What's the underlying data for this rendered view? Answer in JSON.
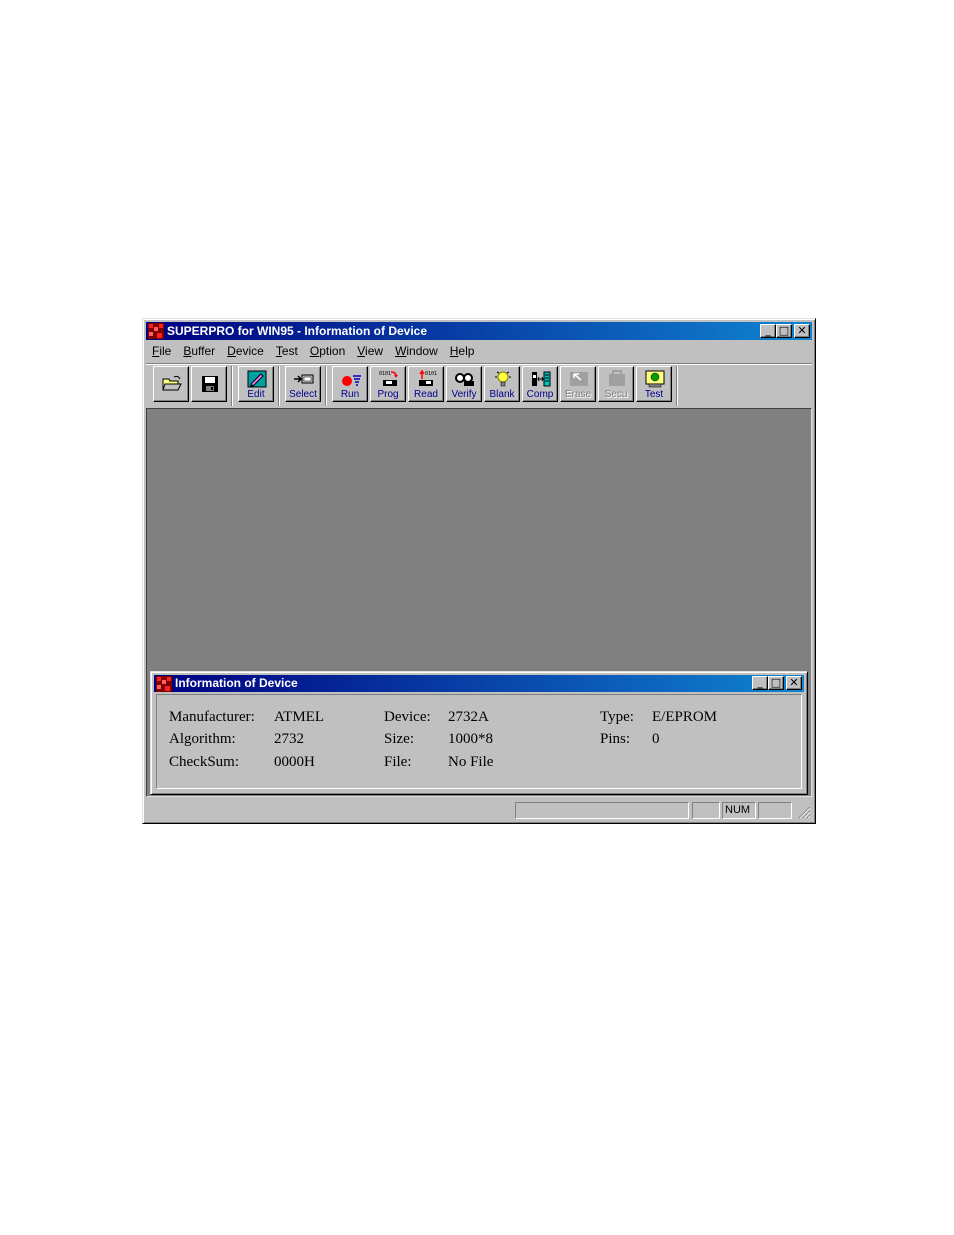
{
  "window": {
    "title": "SUPERPRO for WIN95 - Information of Device",
    "buttons": {
      "minimize": "_",
      "maximize": "□",
      "close": "✕"
    }
  },
  "menu": [
    {
      "label": "File",
      "mnemonic": "F",
      "rest": "ile"
    },
    {
      "label": "Buffer",
      "mnemonic": "B",
      "rest": "uffer"
    },
    {
      "label": "Device",
      "mnemonic": "D",
      "rest": "evice"
    },
    {
      "label": "Test",
      "mnemonic": "T",
      "rest": "est"
    },
    {
      "label": "Option",
      "mnemonic": "O",
      "rest": "ption"
    },
    {
      "label": "View",
      "mnemonic": "V",
      "rest": "iew"
    },
    {
      "label": "Window",
      "mnemonic": "W",
      "rest": "indow"
    },
    {
      "label": "Help",
      "mnemonic": "H",
      "rest": "elp"
    }
  ],
  "toolbar": {
    "open_icon": "folder-open-icon",
    "save_icon": "floppy-disk-icon",
    "edit_label": "Edit",
    "select_label": "Select",
    "run_label": "Run",
    "prog_label": "Prog",
    "read_label": "Read",
    "verify_label": "Verify",
    "blank_label": "Blank",
    "comp_label": "Comp",
    "erase_label": "Erase",
    "secu_label": "Secu",
    "test_label": "Test",
    "prog_chip_text": "0101",
    "read_chip_text": "0101"
  },
  "child_window": {
    "title": "Information of Device"
  },
  "device_info": {
    "manufacturer_label": "Manufacturer:",
    "manufacturer_value": "ATMEL",
    "algorithm_label": "Algorithm:",
    "algorithm_value": "2732",
    "checksum_label": "CheckSum:",
    "checksum_value": "0000H",
    "device_label": "Device:",
    "device_value": "2732A",
    "size_label": "Size:",
    "size_value": "1000*8",
    "file_label": "File:",
    "file_value": "No File",
    "type_label": "Type:",
    "type_value": "E/EPROM",
    "pins_label": "Pins:",
    "pins_value": "0"
  },
  "statusbar": {
    "num_indicator": "NUM"
  },
  "colors": {
    "titlebar_start": "#000080",
    "titlebar_end": "#1084d0",
    "face": "#c0c0c0",
    "mdi_background": "#808080"
  }
}
